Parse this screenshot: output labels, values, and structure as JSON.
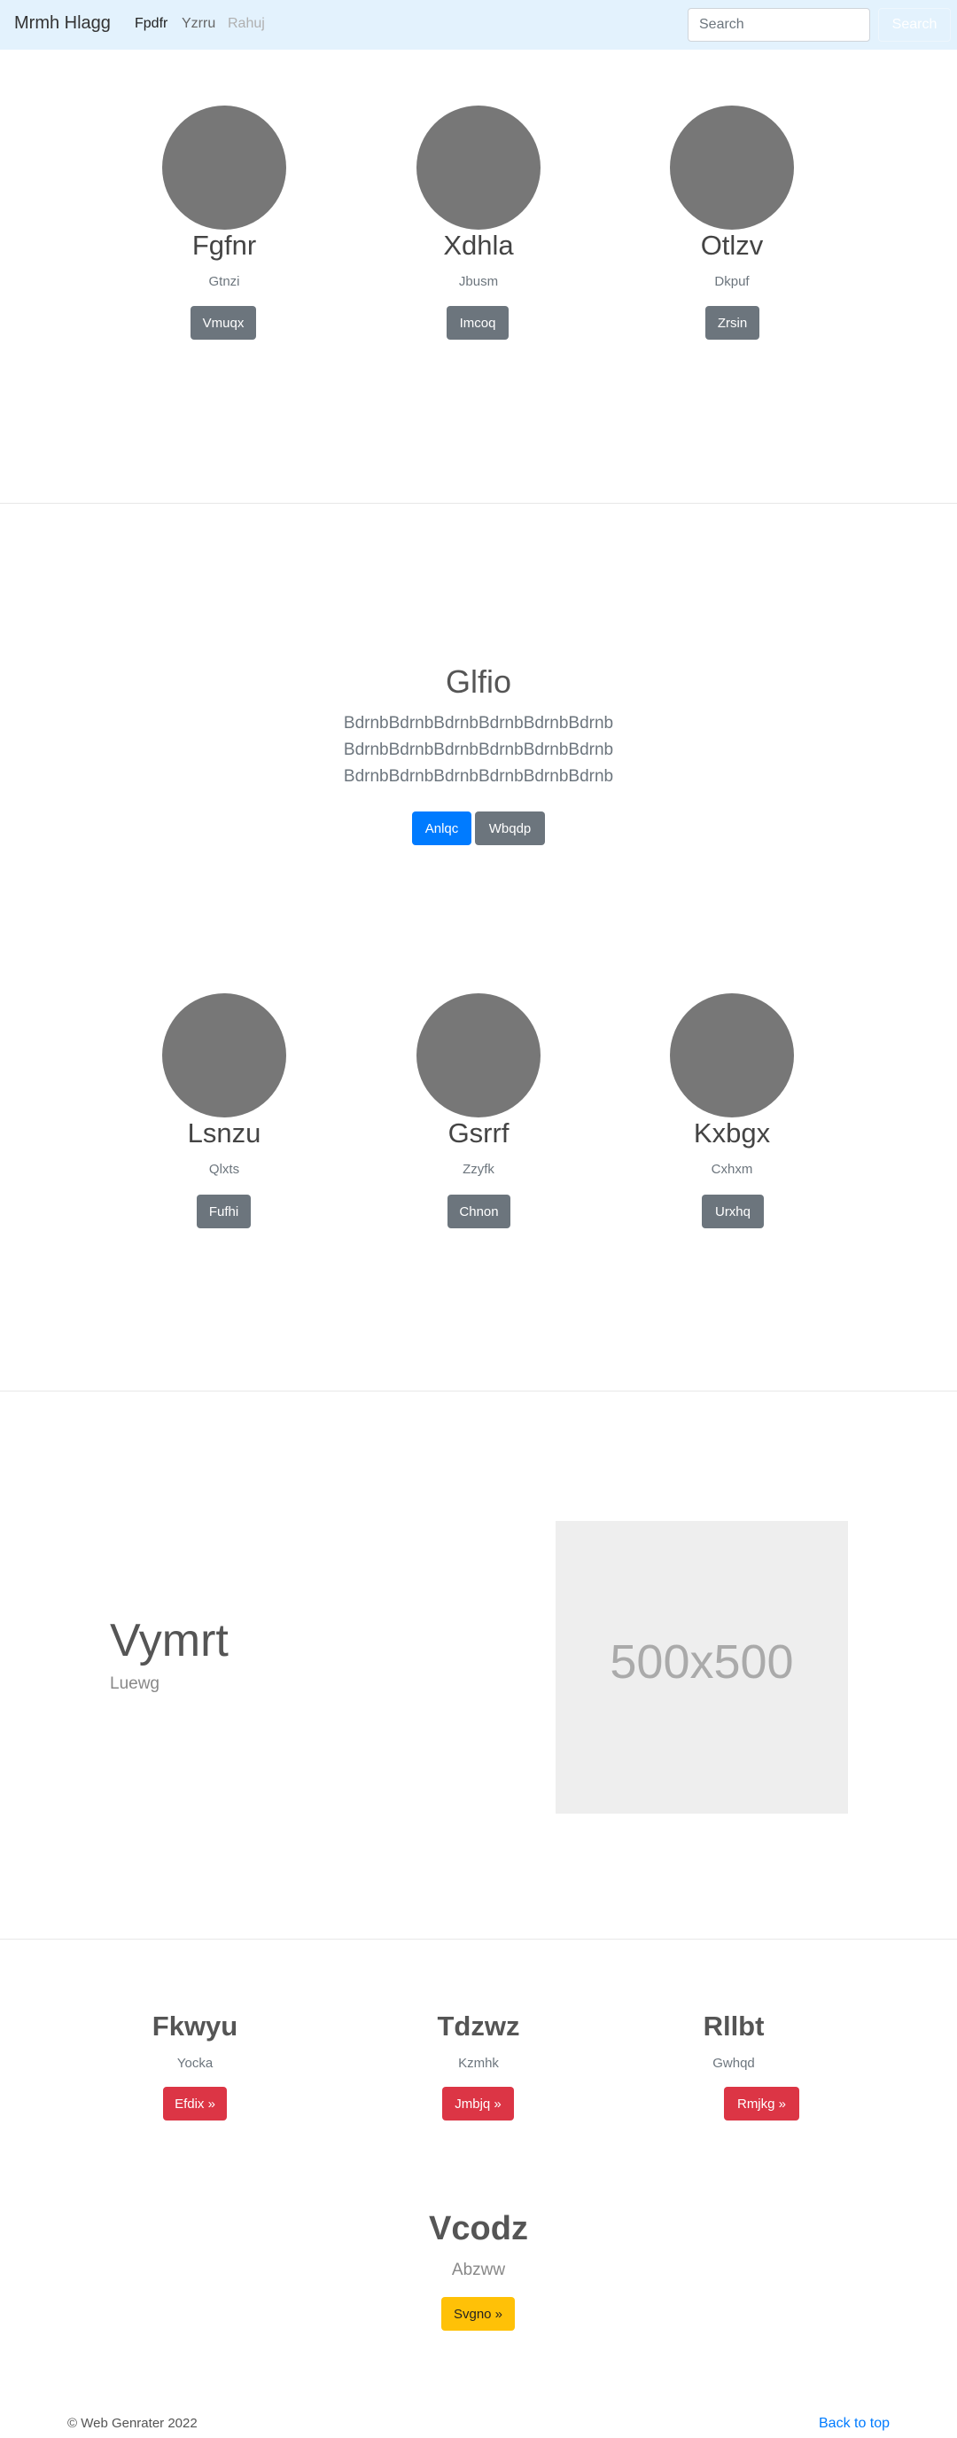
{
  "navbar": {
    "brand": "Mrmh Hlagg",
    "links": [
      "Fpdfr",
      "Yzrru",
      "Rahuj"
    ],
    "search_placeholder": "Search",
    "search_button": "Search"
  },
  "profiles_top": [
    {
      "name": "Fgfnr",
      "sub": "Gtnzi",
      "button": "Vmuqx"
    },
    {
      "name": "Xdhla",
      "sub": "Jbusm",
      "button": "Imcoq"
    },
    {
      "name": "Otlzv",
      "sub": "Dkpuf",
      "button": "Zrsin"
    }
  ],
  "jumbotron": {
    "title": "Glfio",
    "lines": [
      "BdrnbBdrnbBdrnbBdrnbBdrnbBdrnb",
      "BdrnbBdrnbBdrnbBdrnbBdrnbBdrnb",
      "BdrnbBdrnbBdrnbBdrnbBdrnbBdrnb"
    ],
    "primary_button": "Anlqc",
    "secondary_button": "Wbqdp"
  },
  "profiles_bottom": [
    {
      "name": "Lsnzu",
      "sub": "Qlxts",
      "button": "Fufhi"
    },
    {
      "name": "Gsrrf",
      "sub": "Zzyfk",
      "button": "Chnon"
    },
    {
      "name": "Kxbgx",
      "sub": "Cxhxm",
      "button": "Urxhq"
    }
  ],
  "feature": {
    "title": "Vymrt",
    "sub": "Luewg",
    "image_label": "500x500"
  },
  "columns": [
    {
      "title": "Fkwyu",
      "sub": "Yocka",
      "button": "Efdix »"
    },
    {
      "title": "Tdzwz",
      "sub": "Kzmhk",
      "button": "Jmbjq »"
    },
    {
      "title": "Rllbt",
      "sub": "Gwhqd",
      "button": "Rmjkg »"
    }
  ],
  "center_block": {
    "title": "Vcodz",
    "sub": "Abzww",
    "button": "Svgno »"
  },
  "footer": {
    "copyright": "© Web Genrater 2022",
    "back_to_top": "Back to top"
  },
  "colors": {
    "navbar_bg": "#e3f2fd",
    "avatar": "#777777",
    "secondary": "#6c757d",
    "primary": "#007bff",
    "danger": "#dc3545",
    "warning": "#ffc107"
  }
}
